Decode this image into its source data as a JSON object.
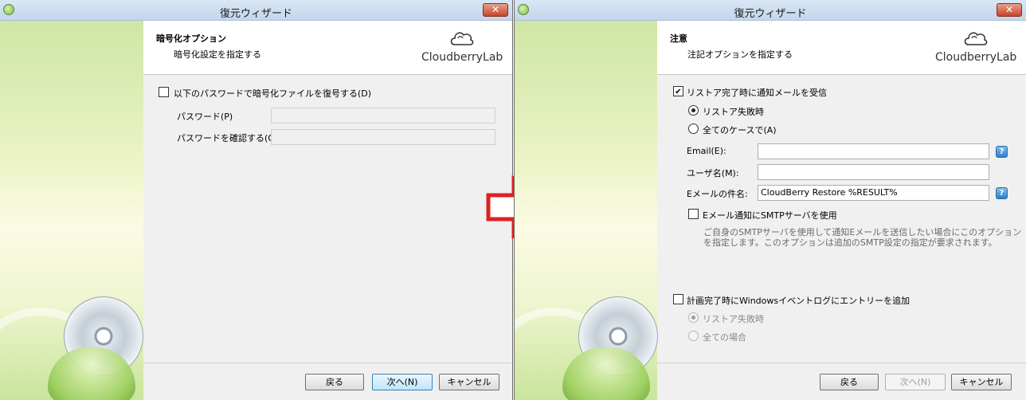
{
  "window_left": {
    "title": "復元ウィザード",
    "close_glyph": "✕",
    "header": {
      "title": "暗号化オプション",
      "subtitle": "暗号化設定を指定する",
      "brand": "CloudberryLab"
    },
    "decrypt_checkbox_label": "以下のパスワードで暗号化ファイルを復号する(D)",
    "password_label": "パスワード(P)",
    "confirm_label": "パスワードを確認する(O)",
    "password_value": "",
    "confirm_value": "",
    "buttons": {
      "back": "戻る",
      "next": "次へ(N)",
      "cancel": "キャンセル"
    }
  },
  "window_right": {
    "title": "復元ウィザード",
    "close_glyph": "✕",
    "header": {
      "title": "注意",
      "subtitle": "注記オプションを指定する",
      "brand": "CloudberryLab"
    },
    "notify_checkbox_label": "リストア完了時に通知メールを受信",
    "radio_failed": "リストア失敗時",
    "radio_all": "全てのケースで(A)",
    "email_label": "Email(E):",
    "email_value": "",
    "username_label": "ユーザ名(M):",
    "username_value": "",
    "subject_label": "Eメールの件名:",
    "subject_value": "CloudBerry Restore %RESULT%",
    "smtp_checkbox_label": "Eメール通知にSMTPサーバを使用",
    "smtp_note_line1": "ご自身のSMTPサーバを使用して通知Eメールを送信したい場合にこのオプション",
    "smtp_note_line2": "を指定します。このオプションは追加のSMTP設定の指定が要求されます。",
    "eventlog_checkbox_label": "計画完了時にWindowsイベントログにエントリーを追加",
    "eventlog_radio_failed": "リストア失敗時",
    "eventlog_radio_all": "全ての場合",
    "help_glyph": "?",
    "buttons": {
      "back": "戻る",
      "next": "次へ(N)",
      "cancel": "キャンセル"
    }
  },
  "colors": {
    "arrow": "#e02020",
    "primary_button": "#3c7fb1",
    "title_bar": "#c3d6ec"
  }
}
